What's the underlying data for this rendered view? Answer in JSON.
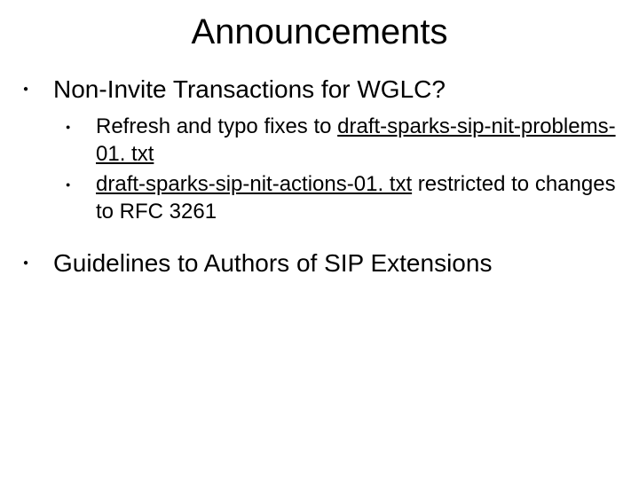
{
  "title": "Announcements",
  "items": [
    {
      "text": "Non-Invite Transactions for WGLC?",
      "sub": [
        {
          "pre": "Refresh and typo fixes to ",
          "link": "draft-sparks-sip-nit-problems-01. txt",
          "post": ""
        },
        {
          "pre": "",
          "link": "draft-sparks-sip-nit-actions-01. txt",
          "post": "  restricted to changes to RFC 3261"
        }
      ]
    },
    {
      "text": "Guidelines to Authors of SIP Extensions",
      "sub": []
    }
  ]
}
